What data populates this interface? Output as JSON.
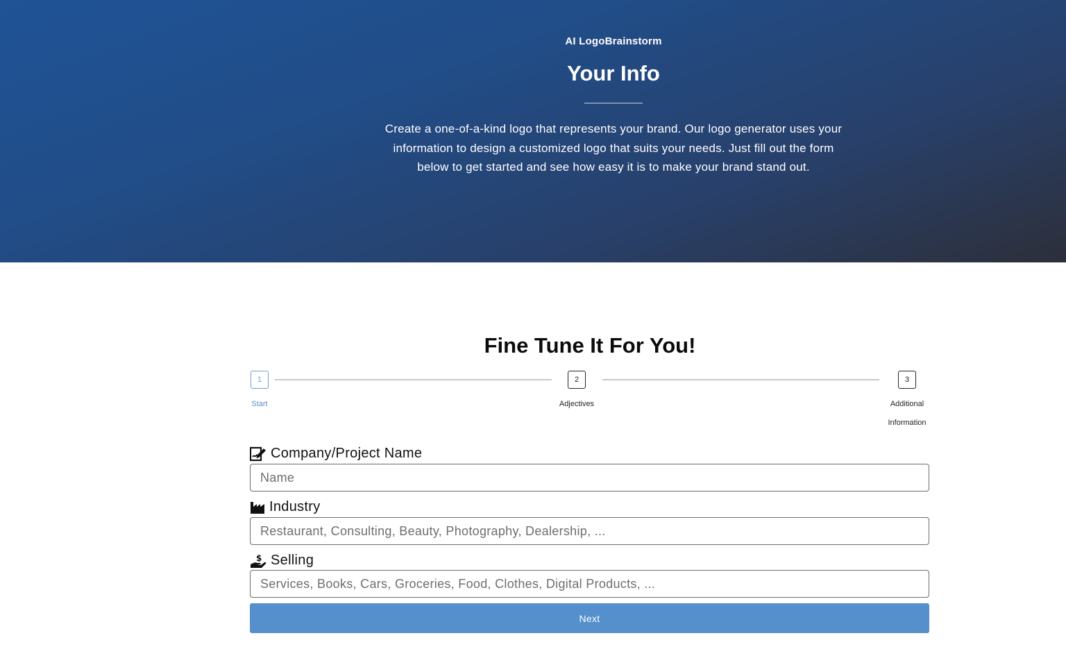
{
  "hero": {
    "brand": "AI LogoBrainstorm",
    "title": "Your Info",
    "description": "Create a one-of-a-kind logo that represents your brand. Our logo generator uses your information to design a customized logo that suits your needs. Just fill out the form below to get started and see how easy it is to make your brand stand out."
  },
  "form": {
    "title": "Fine Tune It For You!",
    "steps": [
      {
        "number": "1",
        "label": "Start",
        "active": true
      },
      {
        "number": "2",
        "label": "Adjectives",
        "active": false
      },
      {
        "number": "3",
        "label": "Additional Information",
        "active": false
      }
    ],
    "fields": {
      "company": {
        "label": "Company/Project Name",
        "placeholder": "Name",
        "value": "",
        "icon": "signature-icon"
      },
      "industry": {
        "label": "Industry",
        "placeholder": "Restaurant, Consulting, Beauty, Photography, Dealership, ...",
        "value": "",
        "icon": "industry-icon"
      },
      "selling": {
        "label": "Selling",
        "placeholder": "Services, Books, Cars, Groceries, Food, Clothes, Digital Products, ...",
        "value": "",
        "icon": "hand-holding-dollar-icon"
      }
    },
    "next_label": "Next"
  },
  "colors": {
    "hero_start": "#1f5396",
    "hero_end": "#2d2f3a",
    "accent": "#5590cd",
    "active_step": "#6f9fd4"
  }
}
